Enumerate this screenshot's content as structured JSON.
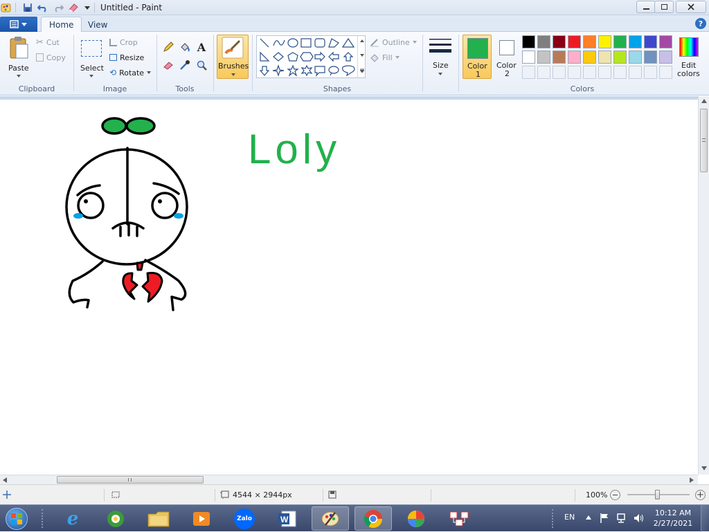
{
  "window": {
    "title": "Untitled - Paint",
    "controls": [
      "minimize",
      "maximize",
      "close"
    ]
  },
  "quick_access": [
    "paint-app-icon",
    "save-icon",
    "undo-icon",
    "redo-icon",
    "eraser-icon",
    "dropdown-icon"
  ],
  "tabs": [
    {
      "label": "Home",
      "active": true
    },
    {
      "label": "View",
      "active": false
    }
  ],
  "ribbon": {
    "clipboard": {
      "paste": "Paste",
      "cut": "Cut",
      "copy": "Copy",
      "group": "Clipboard"
    },
    "image": {
      "select": "Select",
      "crop": "Crop",
      "resize": "Resize",
      "rotate": "Rotate",
      "group": "Image"
    },
    "tools": {
      "group": "Tools"
    },
    "brushes": {
      "label": "Brushes"
    },
    "shapes": {
      "outline": "Outline",
      "fill": "Fill",
      "group": "Shapes"
    },
    "size": {
      "label": "Size"
    },
    "color1": {
      "label": "Color",
      "num": "1",
      "value": "#22b14c"
    },
    "color2": {
      "label": "Color",
      "num": "2",
      "value": "#ffffff"
    },
    "colors": {
      "group": "Colors",
      "edit_label": "Edit",
      "edit_label2": "colors",
      "row1": [
        "#000000",
        "#7f7f7f",
        "#880015",
        "#ed1c24",
        "#ff7f27",
        "#fff200",
        "#22b14c",
        "#00a2e8",
        "#3f48cc",
        "#a349a4"
      ],
      "row2": [
        "#ffffff",
        "#c3c3c3",
        "#b97a57",
        "#ffaec9",
        "#ffc90e",
        "#efe4b0",
        "#b5e61d",
        "#99d9ea",
        "#7092be",
        "#c8bfe7"
      ]
    }
  },
  "canvas": {
    "drawing_text": "Loly",
    "ink_colors": {
      "outline": "#000000",
      "leaf": "#22b14c",
      "heart": "#ed1c24",
      "tear": "#00a2e8"
    }
  },
  "statusbar": {
    "dimensions": "4544 × 2944px",
    "zoom": "100%"
  },
  "taskbar": {
    "apps": [
      "windows-start-icon",
      "internet-explorer-icon",
      "coccoc-browser-icon",
      "file-explorer-icon",
      "media-player-icon",
      "zalo-icon",
      "word-icon",
      "paint-icon",
      "chrome-icon",
      "color-app-icon",
      "network-app-icon"
    ],
    "zalo_label": "Zalo",
    "language": "EN",
    "time": "10:12 AM",
    "date": "2/27/2021"
  }
}
